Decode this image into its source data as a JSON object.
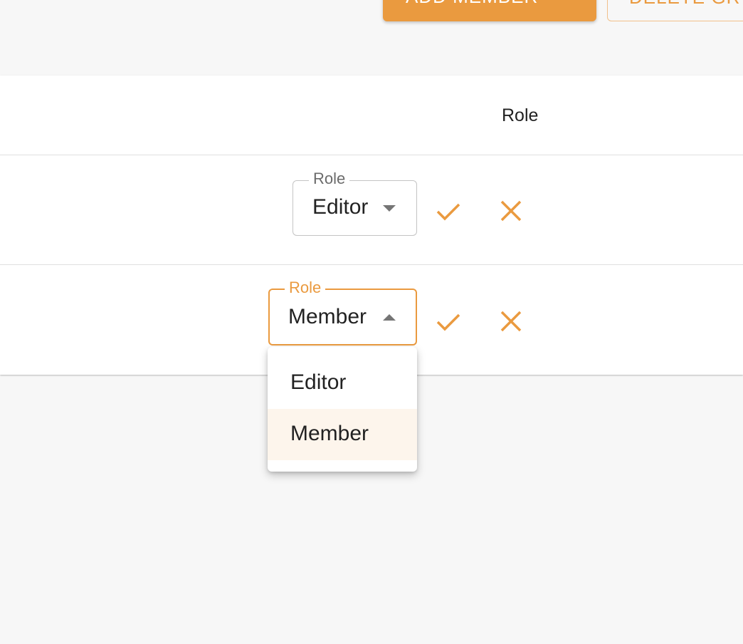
{
  "toolbar": {
    "add_member_label": "ADD MEMBER",
    "delete_label": "DELETE GR"
  },
  "table": {
    "columns": {
      "role": "Role"
    },
    "rows": [
      {
        "role_label": "Role",
        "role_value": "Editor",
        "expanded": false
      },
      {
        "role_label": "Role",
        "role_value": "Member",
        "expanded": true
      }
    ]
  },
  "role_menu": {
    "options": [
      "Editor",
      "Member"
    ],
    "selected": "Member"
  },
  "icons": {
    "add_member": "person-add-icon",
    "confirm": "check-icon",
    "cancel": "close-icon",
    "dropdown_closed": "caret-down-icon",
    "dropdown_open": "caret-up-icon"
  },
  "colors": {
    "accent": "#ea9a3f",
    "selected_option_bg": "#fdf5ec",
    "page_bg": "#f7f7f7"
  }
}
